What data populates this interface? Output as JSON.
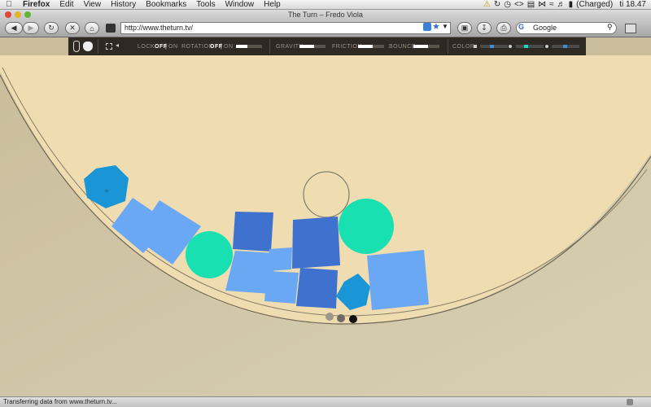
{
  "menubar": {
    "app": "Firefox",
    "menus": [
      "Edit",
      "View",
      "History",
      "Bookmarks",
      "Tools",
      "Window",
      "Help"
    ],
    "battery": "(Charged)",
    "clock": "ti 18.47"
  },
  "window": {
    "title": "The Turn – Fredo Viola"
  },
  "toolbar": {
    "url": "http://www.theturn.tv/",
    "search_engine": "G",
    "search_placeholder": "Google"
  },
  "controls": {
    "lock_label": "LOCK",
    "lock_off": "OFF",
    "lock_on": "ON",
    "rotation_label": "ROTATION",
    "rotation_off": "OFF",
    "rotation_on": "ON",
    "rotation_level": 0.45,
    "gravity_label": "GRAVITY",
    "gravity_level": 0.55,
    "friction_label": "FRICTION",
    "friction_level": 0.55,
    "bounce_label": "BOUNCE",
    "bounce_level": 0.55,
    "color_label": "COLOR",
    "icons": [
      "bunny-icon",
      "cat-face-icon",
      "fullscreen-icon",
      "sound-icon"
    ]
  },
  "colors": {
    "paper": "#efdcb0",
    "blue_light": "#6aa8f4",
    "blue_dark": "#3f72cf",
    "cyan_hex": "#1a95d6",
    "teal": "#18e0b0",
    "bar_bg": "#2e2923"
  },
  "status": {
    "text": "Transferring data from www.theturn.tv..."
  }
}
